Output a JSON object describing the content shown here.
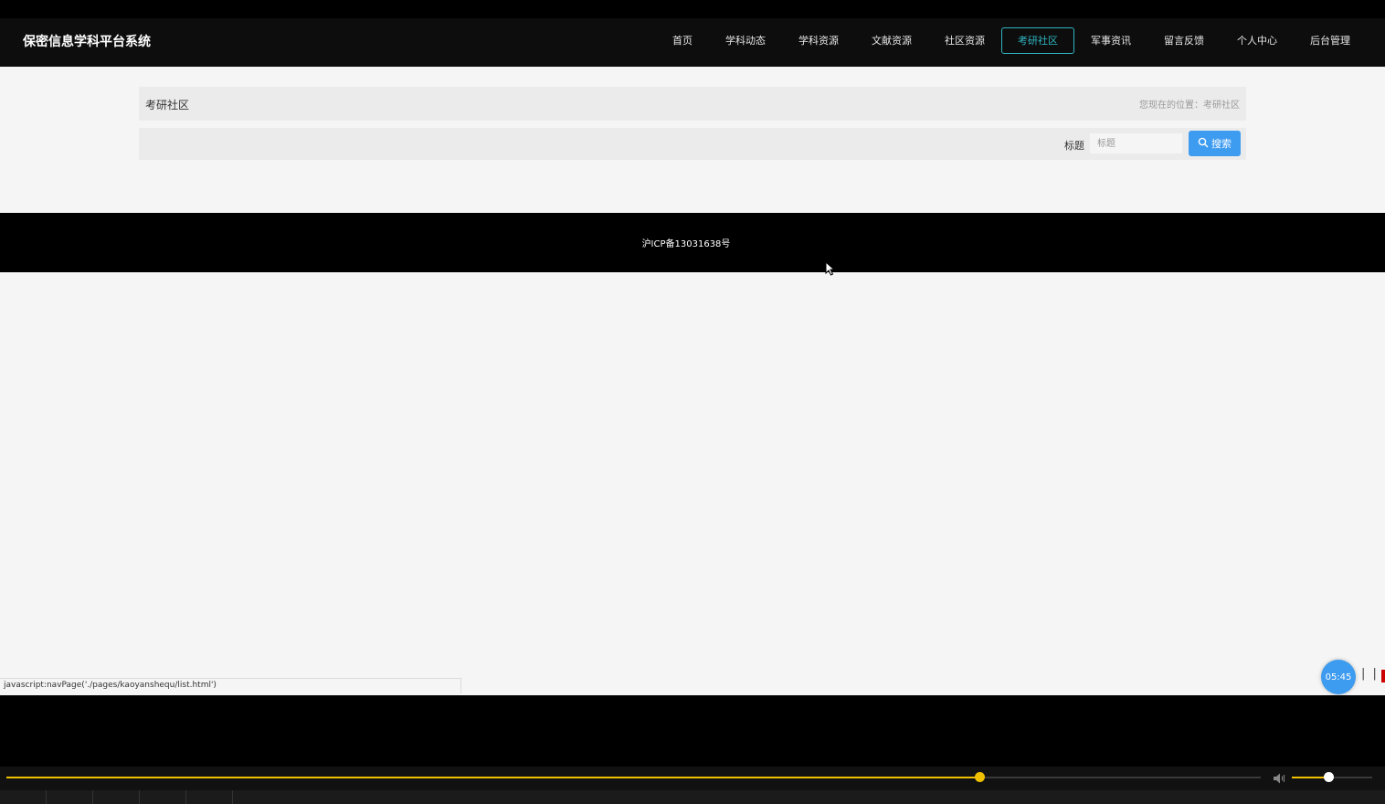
{
  "header": {
    "brand": "保密信息学科平台系统",
    "nav": [
      {
        "label": "首页",
        "active": false
      },
      {
        "label": "学科动态",
        "active": false
      },
      {
        "label": "学科资源",
        "active": false
      },
      {
        "label": "文献资源",
        "active": false
      },
      {
        "label": "社区资源",
        "active": false
      },
      {
        "label": "考研社区",
        "active": true
      },
      {
        "label": "军事资讯",
        "active": false
      },
      {
        "label": "留言反馈",
        "active": false
      },
      {
        "label": "个人中心",
        "active": false
      },
      {
        "label": "后台管理",
        "active": false
      }
    ]
  },
  "breadcrumb": {
    "title": "考研社区",
    "path": "您现在的位置：考研社区"
  },
  "search": {
    "label": "标题",
    "placeholder": "标题",
    "button_label": "搜索"
  },
  "footer": {
    "icp": "沪ICP备13031638号"
  },
  "status_url": "javascript:navPage('./pages/kaoyanshequ/list.html')",
  "video_overlay": {
    "timer": "05:45",
    "pause_symbol": "| |"
  },
  "player": {
    "progress_fraction": 0.776,
    "volume_fraction": 0.45
  },
  "colors": {
    "accent_active": "#2fb5c2",
    "button_blue": "#3d9bf0",
    "player_yellow": "#f0c000"
  }
}
